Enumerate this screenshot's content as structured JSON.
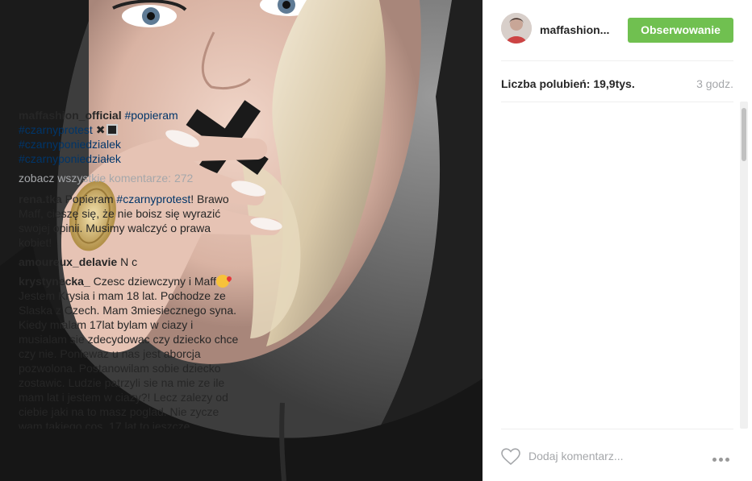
{
  "header": {
    "username": "maffashion...",
    "follow_label": "Obserwowanie"
  },
  "post": {
    "likes": "Liczba polubień: 19,9tys.",
    "time_ago": "3 godz."
  },
  "caption": {
    "user": "maffashion_official",
    "tags": [
      "#popieram",
      "#czarnyprotest",
      "#czarnyponiedzialek",
      "#czarnyponiedziałek"
    ],
    "emoji": "✖"
  },
  "view_all": "zobacz wszystkie komentarze: 272",
  "comments": [
    {
      "user": "rena.tka",
      "pre": "Popieram ",
      "tag": "#czarnyprotest",
      "post": "! Brawo Maff, cieszę się, że nie boisz się wyrazić swojej opinii. Musimy walczyć o prawa kobiet!"
    },
    {
      "user": "amoureux_delavie",
      "text": "N c"
    },
    {
      "user": "krystynecka_",
      "text": "Czesc dziewczyny i Maff",
      "text2": " Jestem Krysia i mam 18 lat. Pochodze ze Slaska z Czech. Mam 3miesiecznego syna. Kiedy mialam 17lat bylam w ciazy i musialam sie zdecydowac czy dziecko chce czy nie. Poniewaz u nas jest aborcja pozwolona. Postanowilam sobie dziecko zostawic. Ludzie patrzyli sie na mie ze ile mam lat i jestem w ciazy?! Lecz zalezy od ciebie jaki na to masz poglad. Nie zycze wam takiego cos. 17 lat to jeszcze"
    }
  ],
  "footer": {
    "comment_placeholder": "Dodaj komentarz..."
  },
  "colors": {
    "follow_green": "#70c050",
    "hashtag_blue": "#003569",
    "muted_gray": "#a5a7aa"
  }
}
